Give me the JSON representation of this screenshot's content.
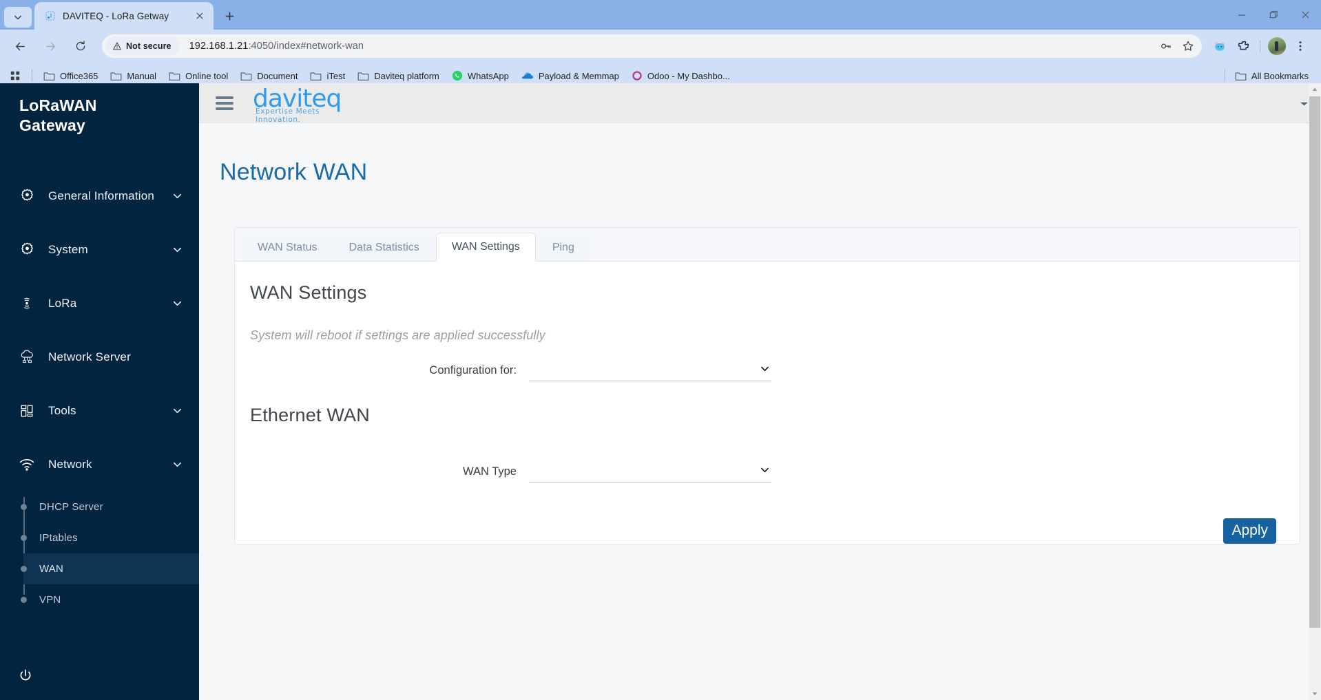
{
  "browser": {
    "tab": {
      "title": "DAVITEQ - LoRa Getway",
      "favicon_name": "daviteq-favicon",
      "close_label": "×",
      "new_tab_label": "+"
    },
    "window_controls": {
      "minimize": "—",
      "maximize": "❐",
      "close": "✕"
    },
    "omnibox": {
      "security_label": "Not secure",
      "url_host": "192.168.1.21",
      "url_rest": ":4050/index#network-wan",
      "full_url": "192.168.1.21:4050/index#network-wan"
    },
    "bookmarks": [
      {
        "label": "Office365",
        "icon": "folder-icon"
      },
      {
        "label": "Manual",
        "icon": "folder-icon"
      },
      {
        "label": "Online tool",
        "icon": "folder-icon"
      },
      {
        "label": "Document",
        "icon": "folder-icon"
      },
      {
        "label": "iTest",
        "icon": "folder-icon"
      },
      {
        "label": "Daviteq platform",
        "icon": "folder-icon"
      },
      {
        "label": "WhatsApp",
        "icon": "whatsapp-icon"
      },
      {
        "label": "Payload & Memmap",
        "icon": "onedrive-icon"
      },
      {
        "label": "Odoo - My Dashbo...",
        "icon": "odoo-icon"
      }
    ],
    "all_bookmarks_label": "All Bookmarks"
  },
  "sidebar": {
    "brand_line1": "LoRaWAN",
    "brand_line2": "Gateway",
    "items": [
      {
        "label": "General Information",
        "icon": "gear-icon",
        "expandable": true
      },
      {
        "label": "System",
        "icon": "gear-icon",
        "expandable": true
      },
      {
        "label": "LoRa",
        "icon": "antenna-icon",
        "expandable": true
      },
      {
        "label": "Network Server",
        "icon": "cloud-network-icon",
        "expandable": false
      },
      {
        "label": "Tools",
        "icon": "grid-blocks-icon",
        "expandable": true
      },
      {
        "label": "Network",
        "icon": "wifi-icon",
        "expandable": true
      }
    ],
    "subitems": [
      {
        "label": "DHCP Server",
        "active": false
      },
      {
        "label": "IPtables",
        "active": false
      },
      {
        "label": "WAN",
        "active": true
      },
      {
        "label": "VPN",
        "active": false
      }
    ],
    "power_icon": "power-icon"
  },
  "appbar": {
    "menu_icon": "hamburger-icon",
    "logo_text": "daviteq",
    "logo_tagline": "Expertise Meets Innovation.",
    "caret_icon": "caret-down-icon"
  },
  "main": {
    "page_title": "Network WAN",
    "tabs": [
      {
        "label": "WAN Status",
        "active": false
      },
      {
        "label": "Data Statistics",
        "active": false
      },
      {
        "label": "WAN Settings",
        "active": true
      },
      {
        "label": "Ping",
        "active": false
      }
    ],
    "section_title": "WAN Settings",
    "note": "System will reboot if settings are applied successfully",
    "fields": [
      {
        "label": "Configuration for:",
        "value": "",
        "placeholder": ""
      }
    ],
    "subsection_title": "Ethernet WAN",
    "fields2": [
      {
        "label": "WAN Type",
        "value": "",
        "placeholder": ""
      }
    ],
    "apply_label": "Apply"
  },
  "colors": {
    "sidebar_bg": "#03243f",
    "sidebar_active": "#0e3353",
    "brand_blue": "#2e9bf0",
    "title_blue": "#1a6aa8",
    "apply_blue": "#1661a0",
    "chrome_tabstrip": "#8ab0e8",
    "chrome_toolbar": "#cfdff7"
  }
}
